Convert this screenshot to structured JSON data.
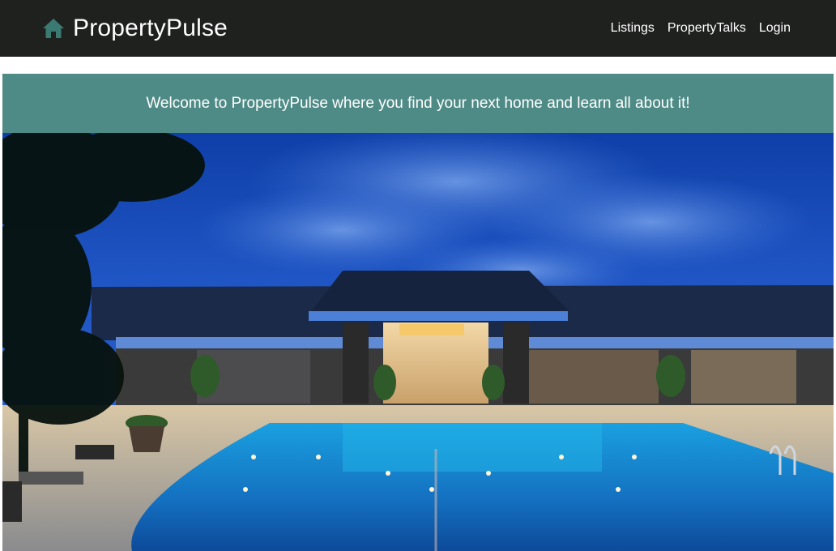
{
  "nav": {
    "brand": "PropertyPulse",
    "brand_icon": "home-icon",
    "links": [
      "Listings",
      "PropertyTalks",
      "Login"
    ]
  },
  "banner": {
    "text": "Welcome to PropertyPulse where you find your next home and learn all about it!"
  },
  "hero": {
    "image": "resort-pool-at-dusk-photo"
  },
  "colors": {
    "navbar_bg": "#1e211e",
    "brand_icon": "#3b7a72",
    "banner_bg": "#4f8b86",
    "text": "#ffffff"
  }
}
